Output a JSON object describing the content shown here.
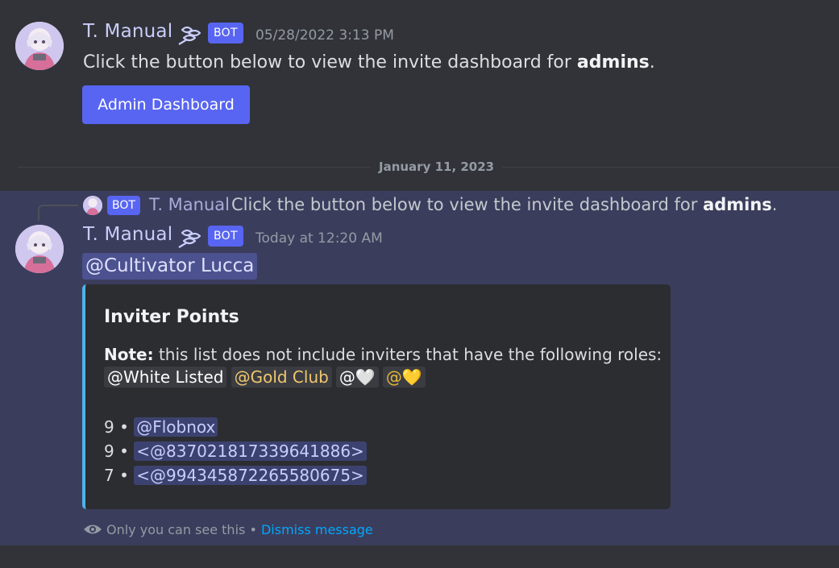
{
  "message1": {
    "username": "T. Manual",
    "bot_tag": "BOT",
    "timestamp": "05/28/2022 3:13 PM",
    "text_before": "Click the button below to view the invite dashboard for ",
    "text_bold": "admins",
    "text_after": ".",
    "button_label": "Admin Dashboard"
  },
  "divider": {
    "date": "January 11, 2023"
  },
  "reply": {
    "bot_tag": "BOT",
    "username": "T. Manual",
    "text_before": "Click the button below to view the invite dashboard for ",
    "text_bold": "admins",
    "text_after": "."
  },
  "message2": {
    "username": "T. Manual",
    "bot_tag": "BOT",
    "timestamp": "Today at 12:20 AM",
    "mention": "@Cultivator Lucca",
    "embed": {
      "title": "Inviter Points",
      "note_label": "Note:",
      "note_text": " this list does not include inviters that have the following roles:",
      "roles": [
        "@White Listed",
        "@Gold Club",
        "@🤍",
        "@💛"
      ],
      "ranks": [
        {
          "points": "9",
          "sep": " • ",
          "user": "@Flobnox"
        },
        {
          "points": "9",
          "sep": " • ",
          "user": "<@837021817339641886>"
        },
        {
          "points": "7",
          "sep": " • ",
          "user": "<@994345872265580675>"
        }
      ]
    },
    "ephemeral_text": "Only you can see this • ",
    "dismiss_label": "Dismiss message"
  },
  "colors": {
    "background": "#313338",
    "blurple": "#5865f2",
    "highlight": "#3b3d5c",
    "embed_bar": "#4fb2e4"
  },
  "icons": {
    "bot_badge": "hypesquad-badge-icon",
    "eye": "eye-icon"
  }
}
